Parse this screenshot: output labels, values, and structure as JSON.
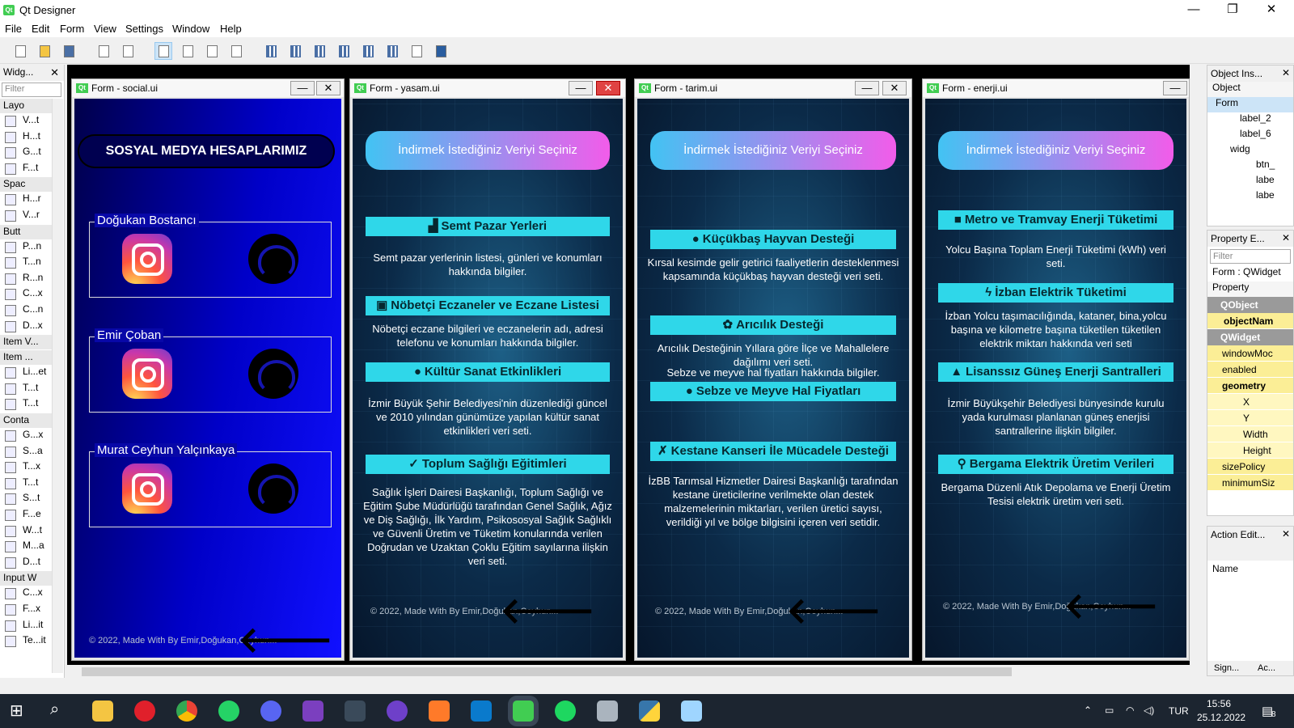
{
  "window": {
    "title": "Qt Designer",
    "minimize": "—",
    "maximize": "❐",
    "close": "✕"
  },
  "menu": [
    "File",
    "Edit",
    "Form",
    "View",
    "Settings",
    "Window",
    "Help"
  ],
  "widget_box": {
    "title": "Widg...",
    "filter_placeholder": "Filter",
    "categories": [
      {
        "label": "Layo",
        "items": [
          "V...t",
          "H...t",
          "G...t",
          "F...t"
        ]
      },
      {
        "label": "Spac",
        "items": [
          "H...r",
          "V...r"
        ]
      },
      {
        "label": "Butt",
        "items": [
          "P...n",
          "T...n",
          "R...n",
          "C...x",
          "C...n",
          "D...x"
        ]
      },
      {
        "label": "Item V...",
        "items": []
      },
      {
        "label": "Item ...",
        "items": [
          "Li...et",
          "T...t",
          "T...t"
        ]
      },
      {
        "label": "Conta",
        "items": [
          "G...x",
          "S...a",
          "T...x",
          "T...t",
          "S...t",
          "F...e",
          "W...t",
          "M...a",
          "D...t"
        ]
      },
      {
        "label": "Input W",
        "items": [
          "C...x",
          "F...x",
          "Li...it",
          "Te...it"
        ]
      }
    ]
  },
  "forms": {
    "social": {
      "title": "Form - social.ui",
      "header": "SOSYAL MEDYA HESAPLARIMIZ",
      "groups": [
        "Doğukan Bostancı",
        "Emir Çoban",
        "Murat Ceyhun Yalçınkaya"
      ],
      "footer": "© 2022, Made With By Emir,Doğukan,Ceyhun..."
    },
    "yasam": {
      "title": "Form - yasam.ui",
      "pill": "İndirmek İstediğiniz Veriyi Seçiniz",
      "sections": [
        {
          "icon": "▟",
          "title": "Semt Pazar Yerleri",
          "desc": "Semt pazar yerlerinin listesi, günleri ve konumları hakkında bilgiler."
        },
        {
          "icon": "▣",
          "title": "Nöbetçi Eczaneler ve Eczane Listesi",
          "desc": "Nöbetçi eczane bilgileri ve eczanelerin adı, adresi telefonu ve konumları hakkında bilgiler."
        },
        {
          "icon": "●",
          "title": "Kültür Sanat Etkinlikleri",
          "desc": "İzmir Büyük Şehir Belediyesi'nin düzenlediği güncel ve 2010 yılından günümüze yapılan kültür sanat etkinlikleri veri seti."
        },
        {
          "icon": "✓",
          "title": "Toplum Sağlığı Eğitimleri",
          "desc": "Sağlık İşleri Dairesi Başkanlığı, Toplum Sağlığı ve Eğitim Şube Müdürlüğü tarafından Genel Sağlık, Ağız ve Diş Sağlığı, İlk Yardım, Psikososyal Sağlık Sağlıklı ve Güvenli Üretim ve Tüketim konularında verilen Doğrudan ve Uzaktan Çoklu Eğitim sayılarına ilişkin veri seti."
        }
      ],
      "footer": "© 2022, Made With By Emir,Doğukan,Ceyhun..."
    },
    "tarim": {
      "title": "Form - tarim.ui",
      "pill": "İndirmek İstediğiniz Veriyi Seçiniz",
      "sections": [
        {
          "icon": "●",
          "title": "Küçükbaş Hayvan Desteği",
          "desc": "Kırsal kesimde gelir getirici faaliyetlerin desteklenmesi kapsamında küçükbaş hayvan desteği veri seti."
        },
        {
          "icon": "✿",
          "title": "Arıcılık Desteği",
          "desc": "Arıcılık Desteğinin Yıllara göre İlçe ve Mahallelere dağılımı veri seti."
        },
        {
          "icon": "●",
          "title": "Sebze ve Meyve Hal Fiyatları",
          "desc": "Sebze ve meyve hal fiyatları hakkında bilgiler."
        },
        {
          "icon": "✗",
          "title": "Kestane Kanseri İle Mücadele Desteği",
          "desc": "İzBB Tarımsal Hizmetler Dairesi Başkanlığı tarafından kestane üreticilerine verilmekte olan destek malzemelerinin miktarları, verilen üretici sayısı, verildiği yıl ve bölge bilgisini içeren veri setidir."
        }
      ],
      "footer": "© 2022, Made With By Emir,Doğukan,Ceyhun..."
    },
    "enerji": {
      "title": "Form - enerji.ui",
      "pill": "İndirmek İstediğiniz Veriyi Seçiniz",
      "sections": [
        {
          "icon": "■",
          "title": "Metro ve Tramvay Enerji Tüketimi",
          "desc": "Yolcu Başına Toplam Enerji Tüketimi (kWh) veri seti."
        },
        {
          "icon": "ϟ",
          "title": "İzban Elektrik Tüketimi",
          "desc": "İzban Yolcu taşımacılığında, kataner, bina,yolcu başına ve kilometre başına tüketilen tüketilen elektrik miktarı hakkında veri seti"
        },
        {
          "icon": "▲",
          "title": "Lisanssız Güneş Enerji Santralleri",
          "desc": "İzmir Büyükşehir Belediyesi bünyesinde kurulu yada kurulması planlanan güneş enerjisi santrallerine ilişkin bilgiler."
        },
        {
          "icon": "⚲",
          "title": "Bergama Elektrik Üretim Verileri",
          "desc": "Bergama Düzenli Atık Depolama ve Enerji Üretim Tesisi elektrik üretim veri seti."
        }
      ],
      "footer": "© 2022, Made With By Emir,Doğukan,Ceyhun..."
    }
  },
  "object_inspector": {
    "title": "Object Ins...",
    "header": "Object",
    "rows": [
      "Form",
      "label_2",
      "label_6",
      "widg",
      "btn_",
      "labe",
      "labe"
    ]
  },
  "property_editor": {
    "title": "Property E...",
    "filter_placeholder": "Filter",
    "context": "Form : QWidget",
    "header": "Property",
    "rows": [
      {
        "label": "QObject",
        "kind": "cat"
      },
      {
        "label": "objectNam",
        "kind": "bold"
      },
      {
        "label": "QWidget",
        "kind": "cat"
      },
      {
        "label": "windowMoc",
        "kind": "y"
      },
      {
        "label": "enabled",
        "kind": "y"
      },
      {
        "label": "geometry",
        "kind": "boldy"
      },
      {
        "label": "X",
        "kind": "sub"
      },
      {
        "label": "Y",
        "kind": "sub"
      },
      {
        "label": "Width",
        "kind": "sub"
      },
      {
        "label": "Height",
        "kind": "sub"
      },
      {
        "label": "sizePolicy",
        "kind": "y"
      },
      {
        "label": "minimumSiz",
        "kind": "y"
      }
    ]
  },
  "action_editor": {
    "title": "Action Edit...",
    "header": "Name",
    "tabs": [
      "Sign...",
      "Ac..."
    ]
  },
  "taskbar": {
    "lang": "TUR",
    "time": "15:56",
    "date": "25.12.2022",
    "notifications": "8"
  },
  "colors": {
    "accent_cyan": "#2fd7e9",
    "pill_start": "#42c3f3",
    "pill_end": "#f25cea",
    "social_blue": "#0000c8"
  }
}
